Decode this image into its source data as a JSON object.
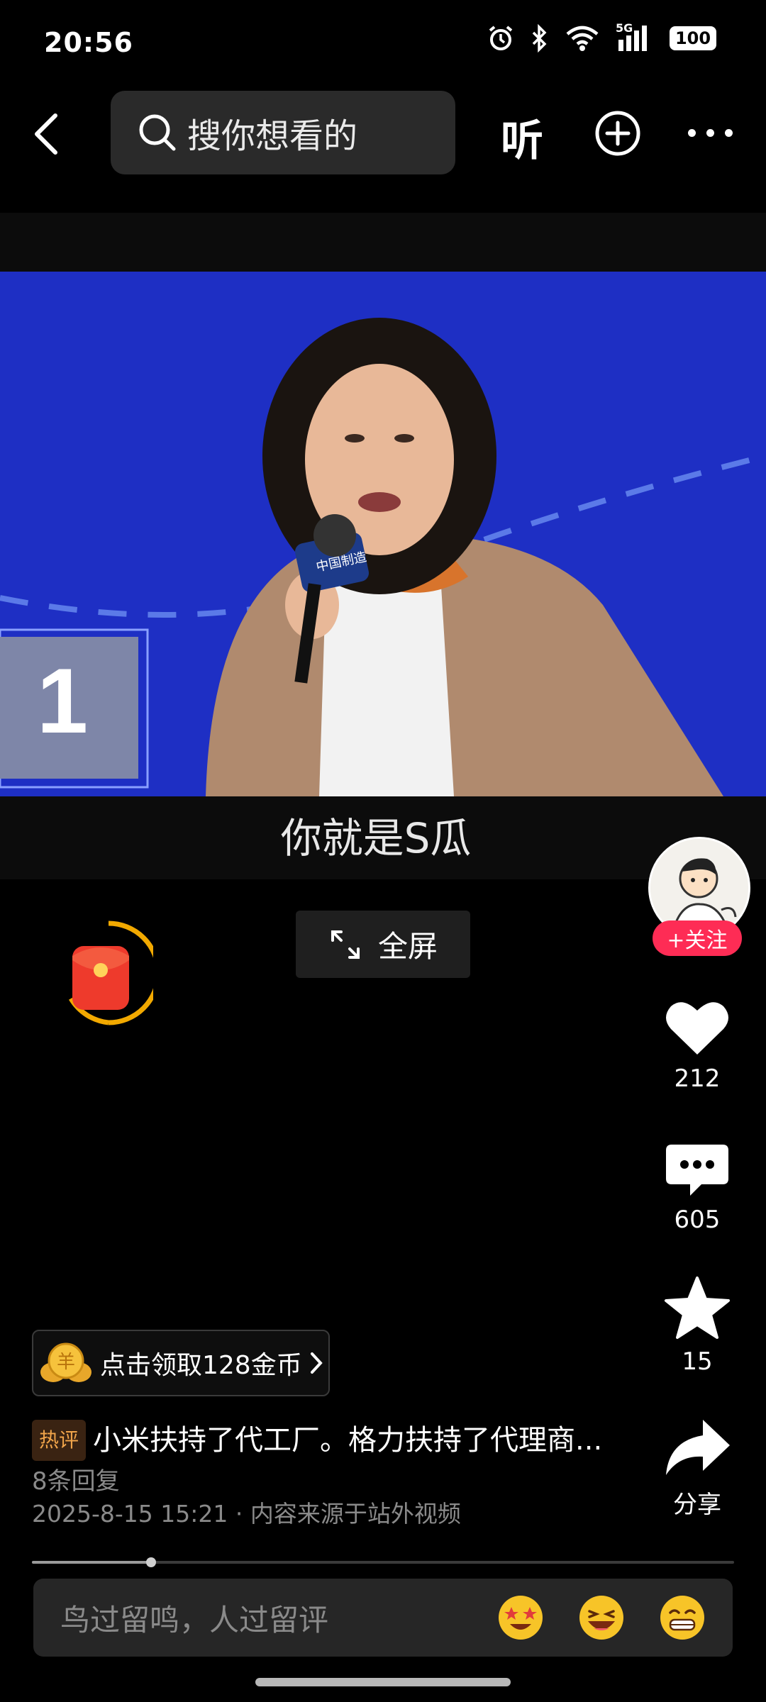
{
  "status_bar": {
    "time": "20:56",
    "network": "5G",
    "battery": "100"
  },
  "top_nav": {
    "search_placeholder": "搜你想看的",
    "listen_label": "听"
  },
  "video": {
    "subtitle": "你就是S瓜",
    "scoreboard_number": "1",
    "mic_text": "中国制造"
  },
  "fullscreen": {
    "label": "全屏"
  },
  "right_rail": {
    "follow_label": "+关注",
    "like_count": "212",
    "comment_count": "605",
    "favorite_count": "15",
    "share_label": "分享"
  },
  "coin_banner": {
    "label": "点击领取128金币",
    "coin_text": "羊"
  },
  "hot_comment": {
    "tag": "热评",
    "text": "小米扶持了代工厂。格力扶持了代理商...",
    "reply_count": "8条回复"
  },
  "meta": {
    "text": "2025-8-15 15:21 · 内容来源于站外视频"
  },
  "progress": {
    "fraction": 0.17
  },
  "comment_input": {
    "placeholder": "鸟过留鸣，人过留评"
  },
  "colors": {
    "accent": "#fe2c55",
    "video_bg": "#1e2fc4",
    "hot_tag": "#f0a44a"
  }
}
